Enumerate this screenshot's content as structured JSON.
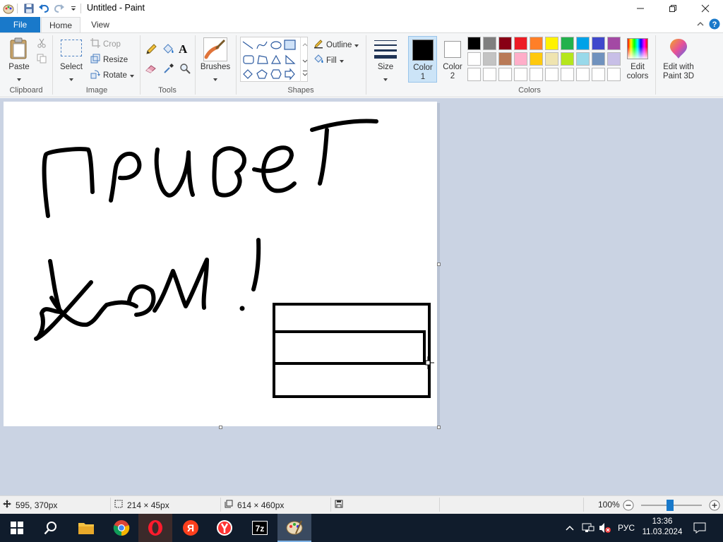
{
  "window": {
    "title": "Untitled - Paint",
    "controls": {
      "minimize": "—",
      "restore": "❐",
      "close": "✕"
    }
  },
  "tabs": {
    "file": "File",
    "home": "Home",
    "view": "View"
  },
  "ribbon": {
    "clipboard": {
      "paste": "Paste",
      "group": "Clipboard"
    },
    "image": {
      "select": "Select",
      "crop": "Crop",
      "resize": "Resize",
      "rotate": "Rotate",
      "group": "Image"
    },
    "tools": {
      "group": "Tools"
    },
    "brushes": {
      "label": "Brushes"
    },
    "shapes": {
      "outline": "Outline",
      "fill": "Fill",
      "group": "Shapes"
    },
    "size": {
      "label": "Size"
    },
    "colors": {
      "color1_label": "Color",
      "color1_num": "1",
      "color2_label": "Color",
      "color2_num": "2",
      "edit_colors_line1": "Edit",
      "edit_colors_line2": "colors",
      "paint3d_line1": "Edit with",
      "paint3d_line2": "Paint 3D",
      "group": "Colors",
      "color1": "#000000",
      "color2": "#ffffff",
      "palette_row1": [
        "#000000",
        "#7f7f7f",
        "#880015",
        "#ed1c24",
        "#ff7f27",
        "#fff200",
        "#22b14c",
        "#00a2e8",
        "#3f48cc",
        "#a349a4"
      ],
      "palette_row2": [
        "#ffffff",
        "#c3c3c3",
        "#b97a57",
        "#ffaec9",
        "#ffc90e",
        "#efe4b0",
        "#b5e61d",
        "#99d9ea",
        "#7092be",
        "#c8bfe7"
      ],
      "palette_row3": [
        "#ffffff",
        "#ffffff",
        "#ffffff",
        "#ffffff",
        "#ffffff",
        "#ffffff",
        "#ffffff",
        "#ffffff",
        "#ffffff",
        "#ffffff"
      ]
    }
  },
  "status": {
    "cursor_pos": "595, 370px",
    "selection_size": "214 × 45px",
    "image_size": "614 × 460px",
    "zoom": "100%",
    "zoom_level": 0.48
  },
  "taskbar": {
    "language": "РУС",
    "time": "13:36",
    "date": "11.03.2024"
  }
}
